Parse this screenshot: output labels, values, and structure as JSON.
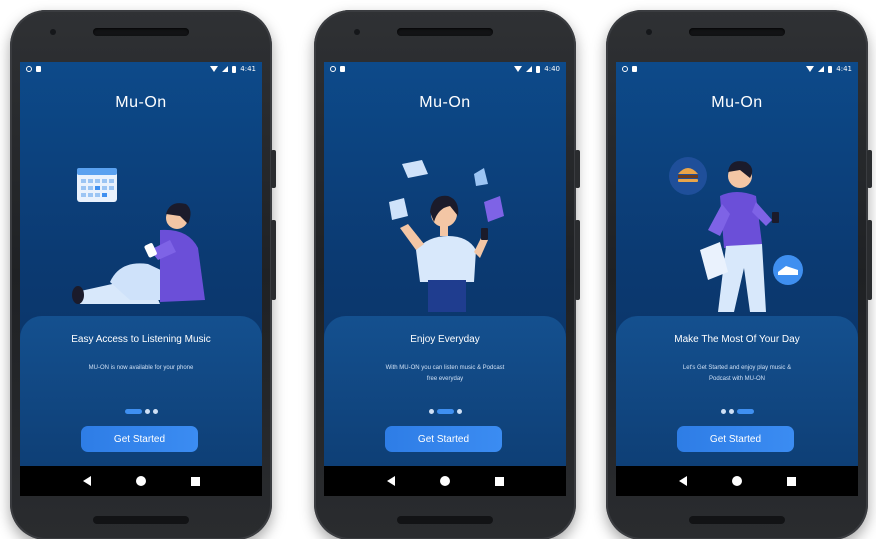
{
  "screens": [
    {
      "status_time": "4:41",
      "app_title": "Mu-On",
      "card_title": "Easy Access to Listening Music",
      "card_desc": "MU-ON is now available for your phone",
      "active_dot": 0,
      "button_label": "Get Started",
      "illustration": "person-sitting-with-phone-and-calendar"
    },
    {
      "status_time": "4:40",
      "app_title": "Mu-On",
      "card_title": "Enjoy Everyday",
      "card_desc": "With MU-ON you can listen music & Podcast free everyday",
      "active_dot": 1,
      "button_label": "Get Started",
      "illustration": "person-with-floating-papers"
    },
    {
      "status_time": "4:41",
      "app_title": "Mu-On",
      "card_title": "Make The Most Of Your Day",
      "card_desc": "Let's Get Started and enjoy play music & Podcast with MU-ON",
      "active_dot": 2,
      "button_label": "Get Started",
      "illustration": "person-walking-with-bag"
    }
  ],
  "colors": {
    "screen_top": "#0d4a8a",
    "screen_bottom": "#0a2f5e",
    "accent": "#3b8cf2",
    "character_purple": "#6b4fd8"
  }
}
